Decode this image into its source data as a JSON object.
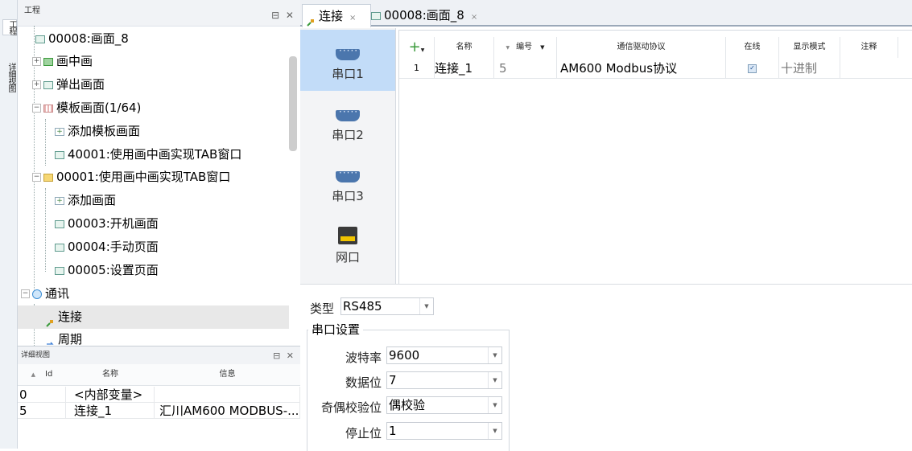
{
  "side_strip": {
    "tab1": "工程",
    "tab2": "详细视图"
  },
  "project_panel": {
    "title": "工程",
    "controls": "⊟ ✕"
  },
  "tree": [
    {
      "label": "00008:画面_8",
      "icon": "screen-icon"
    },
    {
      "label": "画中画",
      "icon": "screen-icon",
      "expander": "+"
    },
    {
      "label": "弹出画面",
      "icon": "screen-icon",
      "expander": "+"
    },
    {
      "label": "模板画面(1/64)",
      "icon": "template-icon",
      "expander": "−"
    },
    {
      "label": "添加模板画面",
      "icon": "add-icon"
    },
    {
      "label": "40001:使用画中画实现TAB窗口",
      "icon": "screen-icon"
    },
    {
      "label": "00001:使用画中画实现TAB窗口",
      "icon": "folder-icon",
      "expander": "−"
    },
    {
      "label": "添加画面",
      "icon": "add-icon"
    },
    {
      "label": "00003:开机画面",
      "icon": "screen-icon"
    },
    {
      "label": "00004:手动页面",
      "icon": "screen-icon"
    },
    {
      "label": "00005:设置页面",
      "icon": "screen-icon"
    },
    {
      "label": "通讯",
      "icon": "globe-icon",
      "expander": "−"
    },
    {
      "label": "连接",
      "icon": "plug-icon",
      "selected": true
    },
    {
      "label": "周期",
      "icon": "cycle-icon"
    }
  ],
  "detail_panel": {
    "title": "详细视图",
    "controls": "⊟ ✕",
    "columns": [
      "Id",
      "名称",
      "信息"
    ],
    "rows": [
      {
        "id": "0",
        "name": "<内部变量>",
        "info": ""
      },
      {
        "id": "5",
        "name": "连接_1",
        "info": "汇川AM600 MODBUS-..."
      }
    ]
  },
  "tabs": [
    {
      "label": "连接",
      "close": "×",
      "active": true
    },
    {
      "label": "00008:画面_8",
      "close": "×",
      "active": false
    }
  ],
  "ports": [
    {
      "label": "串口1",
      "icon": "serial-port-icon",
      "selected": true
    },
    {
      "label": "串口2",
      "icon": "serial-port-icon"
    },
    {
      "label": "串口3",
      "icon": "serial-port-icon"
    },
    {
      "label": "网口",
      "icon": "ethernet-port-icon"
    }
  ],
  "grid": {
    "add_symbol": "+",
    "columns": [
      "名称",
      "编号",
      "通信驱动协议",
      "在线",
      "显示模式",
      "注释"
    ],
    "rows": [
      {
        "index": "1",
        "name": "连接_1",
        "number": "5",
        "protocol": "AM600 Modbus协议",
        "online": true,
        "display_mode": "十进制",
        "comment": ""
      }
    ]
  },
  "serial_settings": {
    "type_label": "类型",
    "type_value": "RS485",
    "group_title": "串口设置",
    "baud_label": "波特率",
    "baud_value": "9600",
    "databits_label": "数据位",
    "databits_value": "7",
    "parity_label": "奇偶校验位",
    "parity_value": "偶校验",
    "stopbits_label": "停止位",
    "stopbits_value": "1"
  },
  "colors": {
    "selection": "#c2dcf8",
    "accent": "#4b76ad"
  }
}
